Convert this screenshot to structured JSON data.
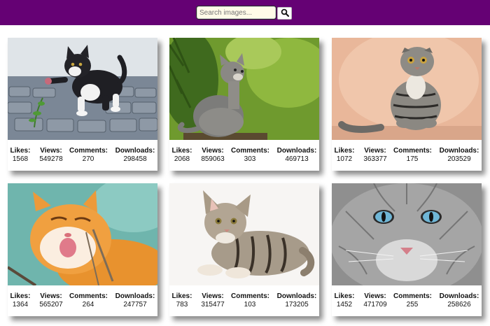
{
  "search": {
    "placeholder": "Search images...",
    "value": ""
  },
  "icons": {
    "search_button": "magnifier-icon"
  },
  "colors": {
    "header": "#650174",
    "search_bg": "#fffbe8"
  },
  "stat_labels": {
    "likes": "Likes:",
    "views": "Views:",
    "comments": "Comments:",
    "downloads": "Downloads:"
  },
  "images": [
    {
      "subject": "kitten-playing-with-plant",
      "likes": "1568",
      "views": "549278",
      "comments": "270",
      "downloads": "298458"
    },
    {
      "subject": "kitten-looking-up-in-grass",
      "likes": "2068",
      "views": "859063",
      "comments": "303",
      "downloads": "469713"
    },
    {
      "subject": "scottish-fold-sitting",
      "likes": "1072",
      "views": "363377",
      "comments": "175",
      "downloads": "203529"
    },
    {
      "subject": "orange-cat-yawning",
      "likes": "1364",
      "views": "565207",
      "comments": "264",
      "downloads": "247757"
    },
    {
      "subject": "tabby-kitten-lying",
      "likes": "783",
      "views": "315477",
      "comments": "103",
      "downloads": "173205"
    },
    {
      "subject": "grey-cat-blue-eyes",
      "likes": "1452",
      "views": "471709",
      "comments": "255",
      "downloads": "258626"
    }
  ]
}
